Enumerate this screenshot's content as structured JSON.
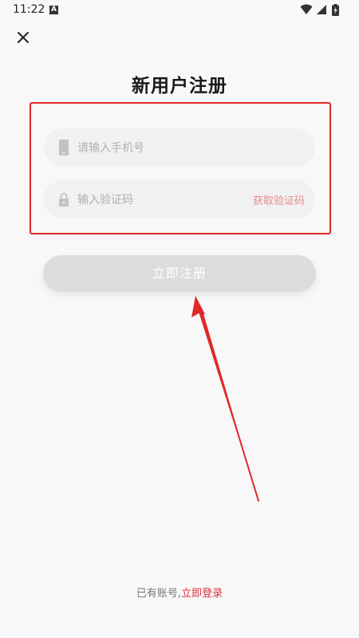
{
  "status_bar": {
    "time": "11:22",
    "notification_icon": "A"
  },
  "header": {
    "close_icon": "close-icon",
    "title": "新用户注册"
  },
  "form": {
    "phone": {
      "placeholder": "请输入手机号",
      "value": "",
      "icon": "phone-icon"
    },
    "code": {
      "placeholder": "输入验证码",
      "value": "",
      "icon": "lock-icon",
      "get_code_label": "获取验证码"
    },
    "register_label": "立即注册"
  },
  "footer": {
    "prompt": "已有账号,",
    "login_link": "立即登录"
  },
  "colors": {
    "accent": "#e0303d",
    "annotation": "#e02828",
    "button_disabled": "#dcdcde"
  }
}
